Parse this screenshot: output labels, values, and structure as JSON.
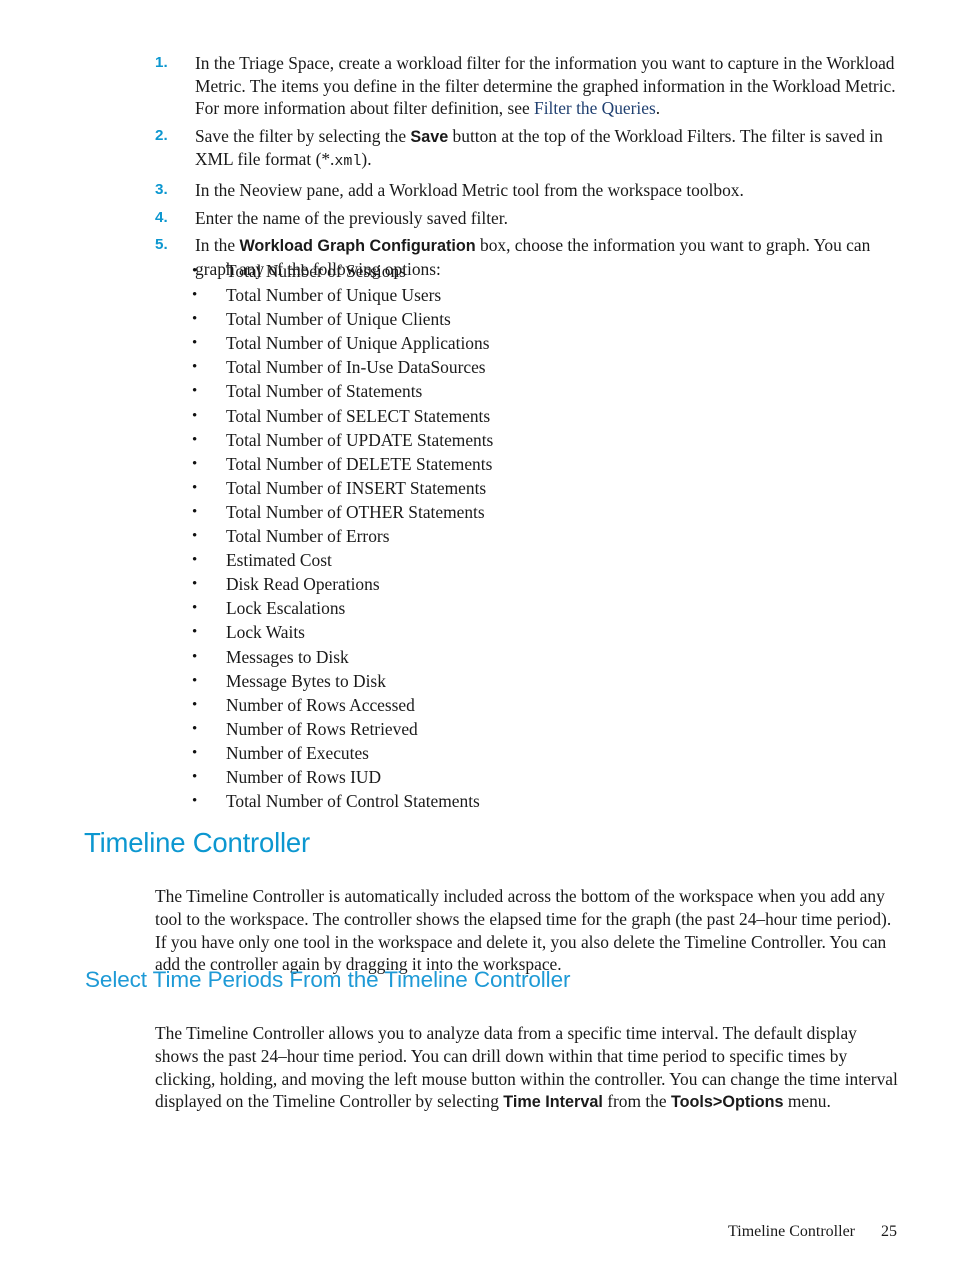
{
  "procedure": {
    "items": [
      {
        "number": "1.",
        "runs": [
          {
            "t": "In the Triage Space, create a workload filter for the information you want to capture in the Workload Metric. The items you define in the filter determine the graphed information in the Workload Metric. For more information about filter definition, see ",
            "s": "n"
          },
          {
            "t": "Filter the Queries",
            "s": "link"
          },
          {
            "t": ".",
            "s": "n"
          }
        ]
      },
      {
        "number": "2.",
        "runs": [
          {
            "t": "Save the filter by selecting the ",
            "s": "n"
          },
          {
            "t": "Save",
            "s": "b"
          },
          {
            "t": " button at the top of the Workload Filters. The filter is saved in XML file format (*.",
            "s": "n"
          },
          {
            "t": "xml",
            "s": "mono"
          },
          {
            "t": ").",
            "s": "n"
          }
        ]
      },
      {
        "number": "3.",
        "runs": [
          {
            "t": "In the Neoview pane, add a Workload Metric tool from the workspace toolbox.",
            "s": "n"
          }
        ]
      },
      {
        "number": "4.",
        "runs": [
          {
            "t": "Enter the name of the previously saved filter.",
            "s": "n"
          }
        ]
      },
      {
        "number": "5.",
        "runs": [
          {
            "t": "In the ",
            "s": "n"
          },
          {
            "t": "Workload Graph Configuration",
            "s": "b"
          },
          {
            "t": " box, choose the information you want to graph. You can graph any of the following options:",
            "s": "n"
          }
        ]
      }
    ]
  },
  "graph_options": {
    "bullet_glyph": "•",
    "items": [
      "Total Number of Sessions",
      "Total Number of Unique Users",
      "Total Number of Unique Clients",
      "Total Number of Unique Applications",
      "Total Number of In-Use DataSources",
      "Total Number of Statements",
      "Total Number of SELECT Statements",
      "Total Number of UPDATE Statements",
      "Total Number of DELETE Statements",
      "Total Number of INSERT Statements",
      "Total Number of OTHER Statements",
      "Total Number of Errors",
      "Estimated Cost",
      "Disk Read Operations",
      "Lock Escalations",
      "Lock Waits",
      "Messages to Disk",
      "Message Bytes to Disk",
      "Number of Rows Accessed",
      "Number of Rows Retrieved",
      "Number of Executes",
      "Number of Rows IUD",
      "Total Number of Control Statements"
    ]
  },
  "section": {
    "heading": "Timeline Controller",
    "paragraph_runs": [
      {
        "t": "The Timeline Controller is automatically included across the bottom of the workspace when you add any tool to the workspace. The controller shows the elapsed time for the graph (the past 24–hour time period). If you have only one tool in the workspace and delete it, you also delete the Timeline Controller. You can add the controller again by dragging it into the workspace.",
        "s": "n"
      }
    ]
  },
  "subsection": {
    "heading": "Select Time Periods From the Timeline Controller",
    "paragraph_runs": [
      {
        "t": "The Timeline Controller allows you to analyze data from a specific time interval. The default display shows the past 24–hour time period. You can drill down within that time period to specific times by clicking, holding, and moving the left mouse button within the controller. You can change the time interval displayed on the Timeline Controller by selecting ",
        "s": "n"
      },
      {
        "t": "Time Interval",
        "s": "b"
      },
      {
        "t": " from the ",
        "s": "n"
      },
      {
        "t": "Tools>Options",
        "s": "b"
      },
      {
        "t": " menu.",
        "s": "n"
      }
    ]
  },
  "footer": {
    "title": "Timeline Controller",
    "page_number": "25"
  },
  "colors": {
    "heading": "#0c97d0",
    "subheading": "#1e9ad6",
    "list_number": "#0c97d0",
    "link": "#1f3f70",
    "body_text": "#1a1a1a"
  }
}
